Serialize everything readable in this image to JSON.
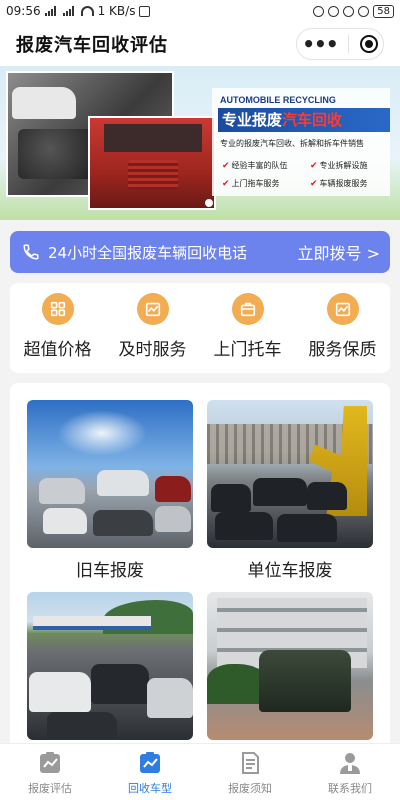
{
  "status_bar": {
    "time": "09:56",
    "network_speed": "1 KB/s",
    "battery": "58"
  },
  "header": {
    "title": "报废汽车回收评估",
    "menu_icon": "more-dots-icon",
    "close_icon": "target-icon"
  },
  "banner": {
    "english_title": "AUTOMOBILE RECYCLING",
    "title_prefix": "专业报废",
    "title_suffix": "汽车回收",
    "description": "专业的报废汽车回收、拆解和拆车件销售",
    "features": [
      "经验丰富的队伍",
      "专业拆解设施",
      "上门拖车服务",
      "车辆报废服务"
    ]
  },
  "hotline": {
    "text": "24小时全国报废车辆回收电话",
    "cta": "立即拨号 >"
  },
  "services": [
    {
      "label": "超值价格",
      "icon": "grid-icon"
    },
    {
      "label": "及时服务",
      "icon": "chart-icon"
    },
    {
      "label": "上门托车",
      "icon": "briefcase-icon"
    },
    {
      "label": "服务保质",
      "icon": "chart-icon"
    }
  ],
  "categories": [
    {
      "label": "旧车报废"
    },
    {
      "label": "单位车报废"
    }
  ],
  "tabs": [
    {
      "label": "报废评估",
      "icon": "chart-icon"
    },
    {
      "label": "回收车型",
      "icon": "chart-icon"
    },
    {
      "label": "报废须知",
      "icon": "document-icon"
    },
    {
      "label": "联系我们",
      "icon": "person-icon"
    }
  ],
  "colors": {
    "accent_blue": "#6c83ee",
    "service_orange": "#f2ad52",
    "tab_active": "#2f7de0"
  }
}
